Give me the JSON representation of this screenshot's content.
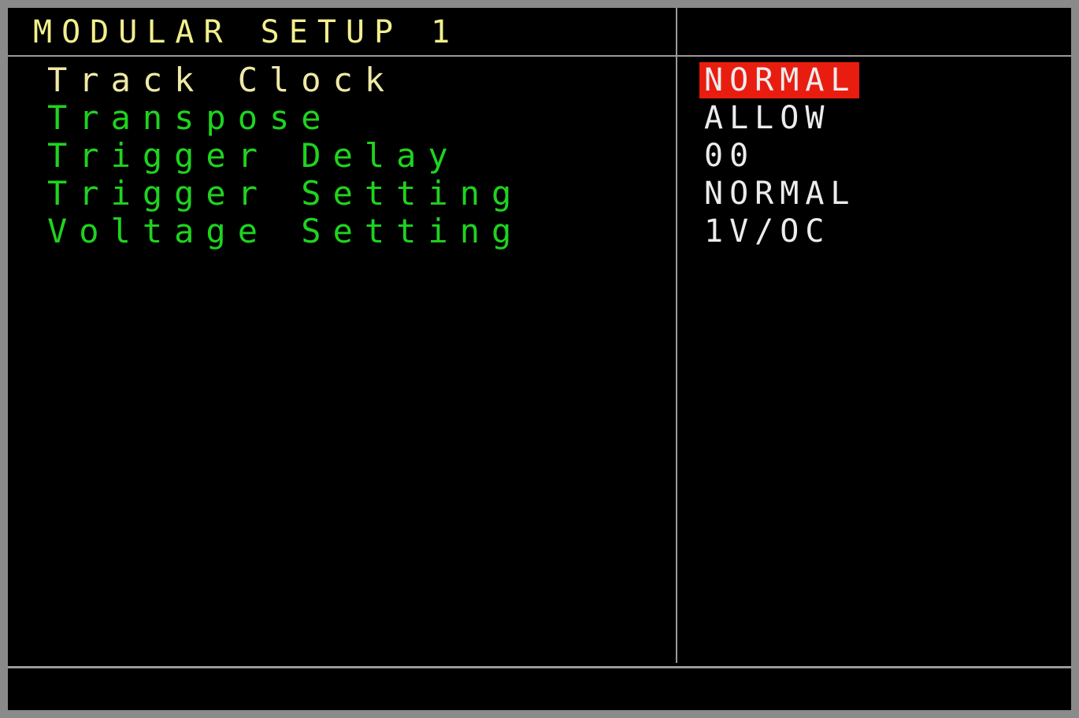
{
  "screen": {
    "title": "MODULAR SETUP 1",
    "selected_index": 0,
    "highlight_color": "#e81d10",
    "label_color": "#1fd31f",
    "selected_label_color": "#efe9a6",
    "title_color": "#f2ef8e"
  },
  "params": [
    {
      "label": "Track Clock",
      "value": "NORMAL"
    },
    {
      "label": "Transpose",
      "value": "ALLOW"
    },
    {
      "label": "Trigger Delay",
      "value": "00"
    },
    {
      "label": "Trigger Setting",
      "value": "NORMAL"
    },
    {
      "label": "Voltage Setting",
      "value": "1V/OC"
    }
  ]
}
